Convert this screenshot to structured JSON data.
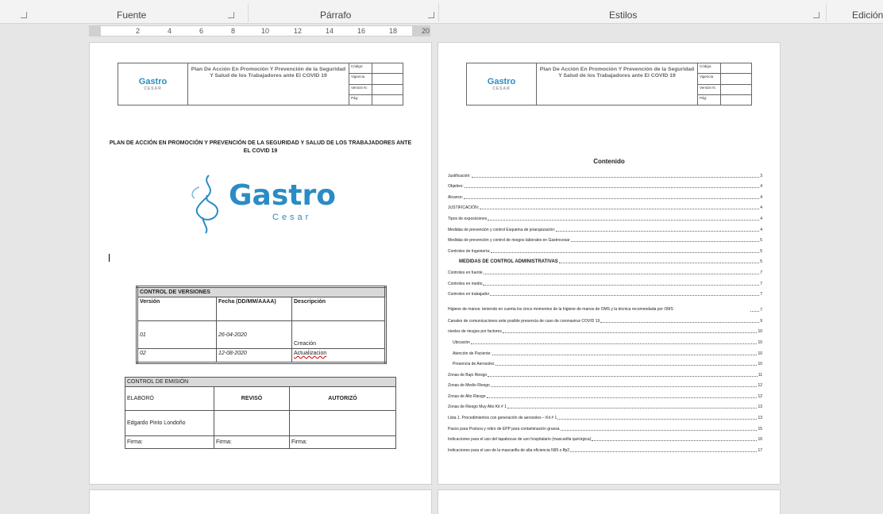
{
  "ribbon": {
    "groups": [
      "Fuente",
      "Párrafo",
      "Estilos",
      "Edición"
    ]
  },
  "ruler": {
    "ticks": [
      "2",
      "4",
      "6",
      "8",
      "10",
      "12",
      "14",
      "16",
      "18",
      "20"
    ]
  },
  "header": {
    "logo_text": "Gastro",
    "logo_sub": "CESAR",
    "title": "Plan De Acción En Promoción Y Prevención de la Seguridad Y Salud de los Trabajadores ante El COVID 19",
    "meta": [
      "Código:",
      "Vigencia",
      "Versión N:",
      "Pág:"
    ]
  },
  "page1": {
    "doc_title": "PLAN DE ACCIÓN EN PROMOCIÓN Y PREVENCIÓN DE LA SEGURIDAD Y SALUD DE LOS TRABAJADORES ANTE EL COVID 19",
    "logo_main": "Gastro",
    "logo_sub": "Cesar",
    "versions": {
      "title": "CONTROL DE VERSIONES",
      "col_version": "Versión",
      "col_fecha": "Fecha (DD/MM/AAAA)",
      "col_desc": "Descripción",
      "rows": [
        {
          "v": "01",
          "f": "26-04-2020",
          "d": "Creación"
        },
        {
          "v": "02",
          "f": "12-08-2020",
          "d": "Actualizacion"
        }
      ]
    },
    "emission": {
      "title": "CONTROL DE EMISIÓN",
      "elaboro": "ELABORÓ",
      "reviso": "REVISÓ",
      "autorizo": "AUTORIZÓ",
      "name": "Edgardo Pinto Londoño",
      "firma": "Firma:"
    }
  },
  "page2": {
    "toc_title": "Contenido",
    "toc": [
      {
        "t": "Justificación:",
        "p": "3"
      },
      {
        "t": "Objetivo:",
        "p": "4"
      },
      {
        "t": "Alcance:",
        "p": "4"
      },
      {
        "t": "JUSTIFICACIÓN:",
        "p": "4"
      },
      {
        "t": "Tipos de exposiciones",
        "p": "4"
      },
      {
        "t": "Medidas de prevención y control Esquema de jerarquización:",
        "p": "4"
      },
      {
        "t": "Medidas de prevención y control de riesgos laborales en Gastrocesar",
        "p": "5"
      },
      {
        "t": "Controles de Ingeniería:",
        "p": "5"
      },
      {
        "t": "MEDIDAS DE CONTROL ADMINISTRATIVAS",
        "p": "5",
        "style": "bold"
      },
      {
        "t": "Controles en fuente",
        "p": "7"
      },
      {
        "t": "Controles en medio",
        "p": "7"
      },
      {
        "t": "Controles en trabajador",
        "p": "7"
      },
      {
        "t": "Higiene de manos: teniendo en cuenta los cinco momentos de la higiene de manos de OMS y la técnica recomendada por OMS",
        "p": "7",
        "style": "tall"
      },
      {
        "t": "Canales de comunicaciones ante posible presencia de caso de coronavirus COVID 19",
        "p": "9"
      },
      {
        "t": "niveles de riesgos por factores",
        "p": "10"
      },
      {
        "t": "Ubicación",
        "p": "10",
        "style": "sub"
      },
      {
        "t": "Atención de Paciente:",
        "p": "10",
        "style": "sub"
      },
      {
        "t": "Presencia de Aerosoles",
        "p": "10",
        "style": "sub"
      },
      {
        "t": "Zonas de Bajo Riesgo",
        "p": "11"
      },
      {
        "t": "Zonas de Medio Riesgo",
        "p": "12"
      },
      {
        "t": "Zonas de Alto Riesgo",
        "p": "12"
      },
      {
        "t": "Zonas de Riesgo Muy Alto Kit # 1",
        "p": "13"
      },
      {
        "t": "Lista 1. Procedimientos con generación de aerosoles – Kit # 1",
        "p": "13"
      },
      {
        "t": "Pasos para Postura y retiro de EPP para contaminación gruesa",
        "p": "15"
      },
      {
        "t": "Indicaciones para el uso del tapabocas de uso hospitalario (mascarilla quirúrgica)",
        "p": "16"
      },
      {
        "t": "Indicaciones para el uso de la mascarilla de alta eficiencia N95 o ffp2",
        "p": "17"
      }
    ]
  }
}
